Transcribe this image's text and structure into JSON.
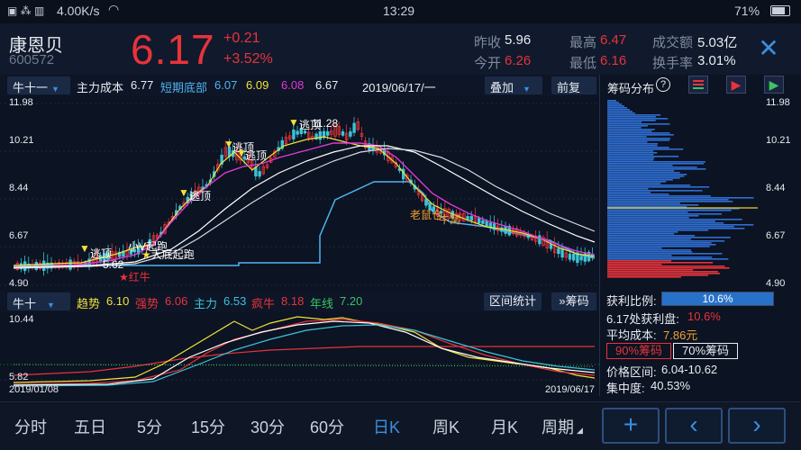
{
  "status_bar": {
    "network_speed": "4.00K/s",
    "time": "13:29",
    "battery": "71%"
  },
  "header": {
    "name": "康恩贝",
    "code": "600572",
    "price": "6.17",
    "change": "+0.21",
    "change_pct": "+3.52%",
    "quotes": [
      {
        "label": "昨收",
        "value": "5.96",
        "color": "white"
      },
      {
        "label": "最高",
        "value": "6.47",
        "color": "red"
      },
      {
        "label": "成交额",
        "value": "5.03亿",
        "color": "white"
      },
      {
        "label": "今开",
        "value": "6.26",
        "color": "red"
      },
      {
        "label": "最低",
        "value": "6.16",
        "color": "red"
      },
      {
        "label": "换手率",
        "value": "3.01%",
        "color": "white"
      }
    ]
  },
  "main_bar": {
    "selector": "牛十一",
    "main_cost_label": "主力成本",
    "main_cost_value": "6.77",
    "short_bottom_label": "短期底部",
    "short_bottom_value": "6.07",
    "v3": "6.09",
    "v4": "6.08",
    "v5": "6.67",
    "date": "2019/06/17/一",
    "overlay": "叠加",
    "adjust": "前复权"
  },
  "price_axis": [
    "11.98",
    "10.21",
    "8.44",
    "6.67",
    "4.90"
  ],
  "annotations": {
    "a1": "逃顶",
    "a2": "逃顶",
    "a3": "逃顶",
    "a4": "逃顶",
    "a5": "逃顶",
    "a6": "小V起跑",
    "a7": "大底起跑",
    "a8": "5.62",
    "a9": "红牛",
    "a10": "11.28",
    "a11": "老鼠仓",
    "a12": "牛窝"
  },
  "sub_bar": {
    "selector": "牛十",
    "trend_label": "趋势",
    "trend_value": "6.10",
    "strong_label": "强势",
    "strong_value": "6.06",
    "main_label": "主力",
    "main_value": "6.53",
    "crazy_label": "疯牛",
    "crazy_value": "8.18",
    "year_label": "年线",
    "year_value": "7.20",
    "interval_btn": "区间统计",
    "chips_btn": "筹码"
  },
  "sub_axis": {
    "top": "10.44",
    "bottom": "5.82",
    "date_start": "2019/01/08",
    "date_end": "2019/06/17"
  },
  "chip_panel": {
    "title": "筹码分布",
    "price_axis": [
      "11.98",
      "10.21",
      "8.44",
      "6.67",
      "4.90"
    ],
    "profit_ratio_label": "获利比例:",
    "profit_ratio_value": "10.6%",
    "profit_ratio": 0.106,
    "profit_at_label": "6.17处获利盘:",
    "profit_at_value": "10.6%",
    "avg_cost_label": "平均成本:",
    "avg_cost_value": "7.86元",
    "chip90": "90%筹码",
    "chip70": "70%筹码",
    "range_label": "价格区间:",
    "range_value": "6.04-10.62",
    "concentration_label": "集中度:",
    "concentration_value": "40.53%"
  },
  "bottom_nav": [
    "分时",
    "五日",
    "5分",
    "15分",
    "30分",
    "60分",
    "日K",
    "周K",
    "月K",
    "周期"
  ],
  "colors": {
    "up": "#e8333b",
    "down": "#3cc4d8",
    "accent": "#3b8fe0",
    "yellow": "#f2e23a",
    "magenta": "#e03ad6",
    "cyan": "#4fb4f0"
  }
}
